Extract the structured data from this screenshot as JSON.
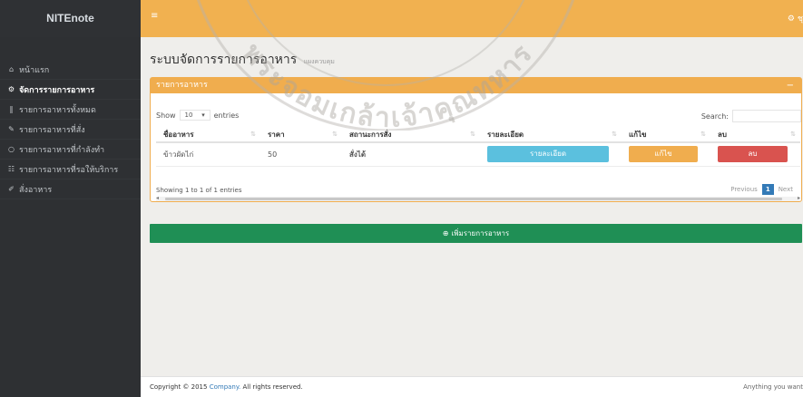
{
  "app": {
    "brand": "NITEnote"
  },
  "topbar": {
    "menu_glyph": "≡",
    "user_label": "ชุ"
  },
  "sidebar": {
    "items": [
      {
        "label": "หน้าแรก",
        "icon": "home-icon",
        "glyph": "⌂"
      },
      {
        "label": "จัดการรายการอาหาร",
        "icon": "gear-icon",
        "glyph": "⚙"
      },
      {
        "label": "รายการอาหารทั้งหมด",
        "icon": "cutlery-icon",
        "glyph": "‖"
      },
      {
        "label": "รายการอาหารที่สั่ง",
        "icon": "edit-icon",
        "glyph": "✎"
      },
      {
        "label": "รายการอาหารที่กำลังทำ",
        "icon": "circle-icon",
        "glyph": "○"
      },
      {
        "label": "รายการอาหารที่รอให้บริการ",
        "icon": "list-icon",
        "glyph": "☷"
      },
      {
        "label": "สั่งอาหาร",
        "icon": "pencil-icon",
        "glyph": "✐"
      }
    ]
  },
  "page": {
    "title": "ระบบจัดการรายการอาหาร",
    "subtitle": "แผงควบคุม"
  },
  "panel": {
    "heading": "รายการอาหาร",
    "collapse_glyph": "−"
  },
  "table_controls": {
    "show_label": "Show",
    "length_value": "10",
    "entries_label": "entries",
    "search_label": "Search:",
    "search_value": ""
  },
  "table": {
    "columns": [
      "ชื่ออาหาร",
      "ราคา",
      "สถานะการสั่ง",
      "รายละเอียด",
      "แก้ไข",
      "ลบ"
    ],
    "rows": [
      {
        "name": "ข้าวผัดไก่",
        "price": "50",
        "status": "สั่งได้",
        "detail_button": "รายละเอียด",
        "edit_button": "แก้ไข",
        "delete_button": "ลบ"
      }
    ]
  },
  "table_footer": {
    "info": "Showing 1 to 1 of 1 entries",
    "previous": "Previous",
    "current_page": "1",
    "next": "Next"
  },
  "add_button": {
    "label": "เพิ่มรายการอาหาร",
    "glyph": "⊕"
  },
  "footer": {
    "copyright_prefix": "Copyright © 2015",
    "company": "Company.",
    "rights": "All rights reserved.",
    "right_text": "Anything you want"
  },
  "watermark": {
    "text": "พระจอมเกล้าเจ้าคุณทหาร"
  },
  "colors": {
    "topbar": "#f1b150",
    "sidebar": "#2e3033",
    "panel_heading": "#f0ad4e",
    "info_button": "#5bc0de",
    "warning_button": "#f0ad4e",
    "danger_button": "#d9534f",
    "add_button": "#1f8f55",
    "status_ok": "#4a8a2f"
  }
}
